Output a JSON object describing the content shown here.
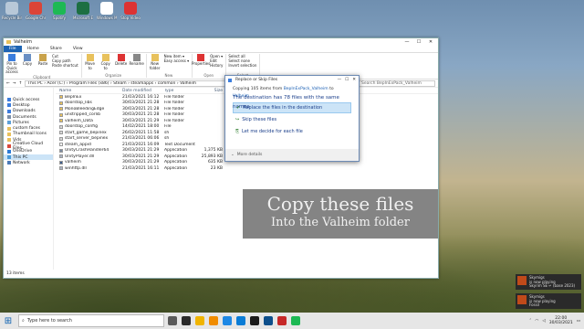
{
  "desktop": {
    "icons": [
      {
        "label": "Recycle Bin",
        "color": "#b8c8d8"
      },
      {
        "label": "Google Chrome",
        "color": "#db4437"
      },
      {
        "label": "Spotify",
        "color": "#1db954"
      },
      {
        "label": "Microsoft Excel",
        "color": "#1d6f42"
      },
      {
        "label": "Windows Media",
        "color": "#ffffff"
      },
      {
        "label": "Stop Video",
        "color": "#d33"
      }
    ]
  },
  "explorer": {
    "title": "Valheim",
    "window_controls": [
      "—",
      "☐",
      "✕"
    ],
    "tabs": [
      "File",
      "Home",
      "Share",
      "View"
    ],
    "ribbon": {
      "clipboard": {
        "name": "Clipboard",
        "pin": "Pin to Quick access",
        "copy": "Copy",
        "paste": "Paste",
        "cut": "Cut",
        "copy_path": "Copy path",
        "paste_shortcut": "Paste shortcut"
      },
      "organize": {
        "name": "Organize",
        "move_to": "Move to",
        "copy_to": "Copy to",
        "delete": "Delete",
        "rename": "Rename"
      },
      "new": {
        "name": "New",
        "new_folder": "New folder",
        "new_item": "New item ▾",
        "easy_access": "Easy access ▾"
      },
      "open": {
        "name": "Open",
        "properties": "Properties",
        "open": "Open ▾",
        "edit": "Edit",
        "history": "History"
      },
      "select": {
        "name": "Select",
        "select_all": "Select all",
        "select_none": "Select none",
        "invert": "Invert selection"
      }
    },
    "address": "This PC  ›  Acer (C:)  ›  Program Files (x86)  ›  Steam  ›  steamapps  ›  common  ›  Valheim",
    "search_placeholder": "Search BepInExPack_Valheim",
    "nav": [
      {
        "label": "Quick access",
        "color": "#3b7ddd"
      },
      {
        "label": "Desktop",
        "color": "#3b7ddd"
      },
      {
        "label": "Downloads",
        "color": "#3b7ddd"
      },
      {
        "label": "Documents",
        "color": "#7b8fa8"
      },
      {
        "label": "Pictures",
        "color": "#5ca0d8"
      },
      {
        "label": "custom faces",
        "color": "#e8c15c"
      },
      {
        "label": "Thumbnail Icons",
        "color": "#e8c15c"
      },
      {
        "label": "Vids",
        "color": "#e8c15c"
      },
      {
        "label": "Creative Cloud Files",
        "color": "#d94a3b"
      },
      {
        "label": "OneDrive",
        "color": "#2c7bd6"
      },
      {
        "label": "This PC",
        "color": "#4a9ad8"
      },
      {
        "label": "Network",
        "color": "#4a7ab8"
      }
    ],
    "columns": [
      "Name",
      "Date modified",
      "Type",
      "Size"
    ],
    "files": [
      {
        "name": "BepInEx",
        "date": "21/03/2021 16:12",
        "type": "File folder",
        "size": "",
        "color": "#e8c15c"
      },
      {
        "name": "doorstop_libs",
        "date": "30/03/2021 21:28",
        "type": "File folder",
        "size": "",
        "color": "#e8c15c"
      },
      {
        "name": "MonoBleedingEdge",
        "date": "30/03/2021 21:28",
        "type": "File folder",
        "size": "",
        "color": "#e8c15c"
      },
      {
        "name": "unstripped_corlib",
        "date": "30/03/2021 21:28",
        "type": "File folder",
        "size": "",
        "color": "#e8c15c"
      },
      {
        "name": "valheim_Data",
        "date": "30/03/2021 21:29",
        "type": "File folder",
        "size": "",
        "color": "#e8c15c"
      },
      {
        "name": "doorstop_config",
        "date": "14/02/2021 18:00",
        "type": "File",
        "size": "",
        "color": "#d9d9d9"
      },
      {
        "name": "start_game_bepinex",
        "date": "26/02/2021 11:58",
        "type": "sh",
        "size": "",
        "color": "#d9d9d9"
      },
      {
        "name": "start_server_bepinex",
        "date": "21/03/2021 06:06",
        "type": "sh",
        "size": "",
        "color": "#d9d9d9"
      },
      {
        "name": "steam_appid",
        "date": "21/03/2021 16:09",
        "type": "Text Document",
        "size": "",
        "color": "#ffffff"
      },
      {
        "name": "UnityCrashHandler64",
        "date": "30/03/2021 21:29",
        "type": "Application",
        "size": "1,375 KB",
        "color": "#7a8aa0"
      },
      {
        "name": "UnityPlayer.dll",
        "date": "30/03/2021 21:29",
        "type": "Application",
        "size": "25,893 KB",
        "color": "#aab4c4"
      },
      {
        "name": "valheim",
        "date": "30/03/2021 21:29",
        "type": "Application",
        "size": "635 KB",
        "color": "#3a5c8a"
      },
      {
        "name": "winhttp.dll",
        "date": "21/03/2021 16:11",
        "type": "Application",
        "size": "23 KB",
        "color": "#aab4c4"
      }
    ],
    "status": "13 items"
  },
  "dialog": {
    "title": "Replace or Skip Files",
    "copying_prefix": "Copying 105 items from",
    "copying_from": "BepInExPack_Valheim",
    "copying_to_word": "to",
    "copying_to": "Valheim",
    "heading": "The destination has 78 files with the same names",
    "options": [
      {
        "icon": "✔",
        "label": "Replace the files in the destination",
        "selected": true
      },
      {
        "icon": "↪",
        "label": "Skip these files",
        "selected": false
      },
      {
        "icon": "⎘",
        "label": "Let me decide for each file",
        "selected": false
      }
    ],
    "more_details": "More details"
  },
  "overlay": {
    "line1": "Copy these files",
    "line2": "Into the Valheim folder"
  },
  "notifications": [
    {
      "app": "Skymigs",
      "line1": "is now playing",
      "line2": "Skyrim SE ↵ (base 2023)"
    },
    {
      "app": "Skymigs",
      "line1": "is now playing",
      "line2": "Fossil"
    }
  ],
  "taskbar": {
    "search_placeholder": "Type here to search",
    "apps": [
      "#5a5a5a",
      "#2a2a2a",
      "#f0b400",
      "#f08c00",
      "#1e88e5",
      "#0a7cd6",
      "#1b1b1b",
      "#0d4f8b",
      "#c62828",
      "#1db954"
    ],
    "time": "22:00",
    "date": "30/03/2021"
  }
}
